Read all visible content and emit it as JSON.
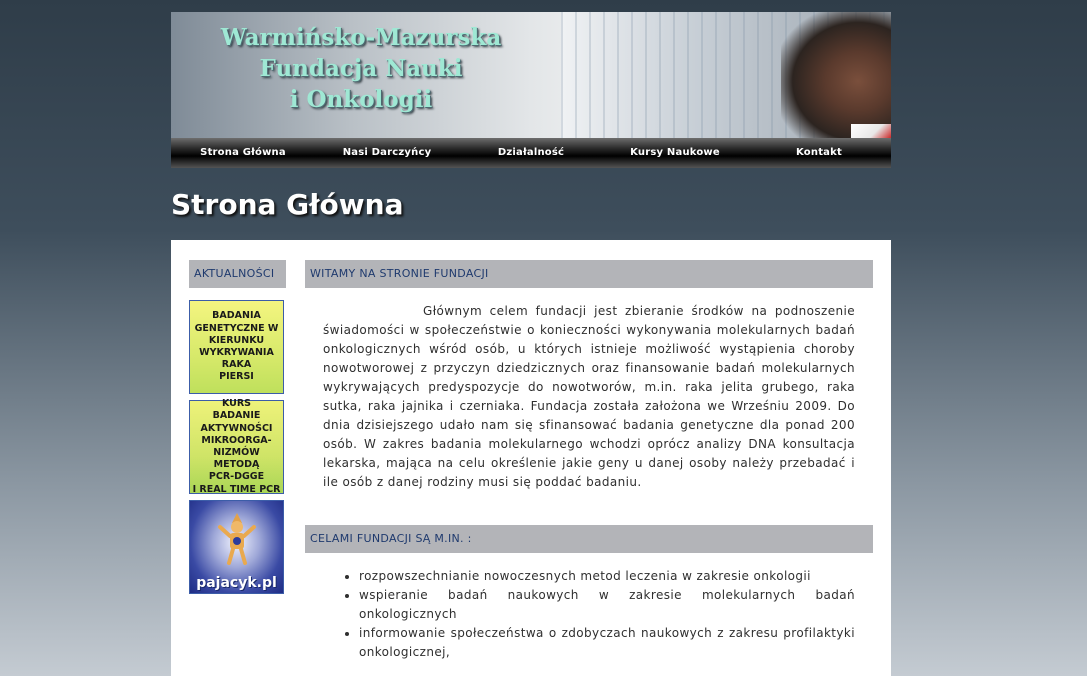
{
  "banner": {
    "title_lines": [
      "Warmińsko-Mazurska",
      "Fundacja Nauki",
      "i Onkologii"
    ]
  },
  "nav": {
    "items": [
      "Strona Główna",
      "Nasi Darczyńcy",
      "Działalność",
      "Kursy Naukowe",
      "Kontakt"
    ]
  },
  "page_title": "Strona Główna",
  "sidebar": {
    "heading": "AKTUALNOŚCI",
    "promos": [
      {
        "lines": [
          "BADANIA",
          "GENETYCZNE W",
          "KIERUNKU",
          "WYKRYWANIA",
          "RAKA",
          "PIERSI"
        ]
      },
      {
        "lines": [
          "KURS",
          "BADANIE",
          "AKTYWNOŚCI",
          "MIKROORGA-",
          "NIZMÓW METODĄ",
          "PCR-DGGE",
          "I REAL TIME PCR"
        ]
      },
      {
        "label": "pajacyk.pl"
      }
    ]
  },
  "main": {
    "welcome_heading": "WITAMY NA STRONIE FUNDACJI",
    "welcome_text": "Głównym celem fundacji jest zbieranie środków na podnoszenie świadomości w społeczeństwie o konieczności wykonywania molekularnych badań onkologicznych wśród osób, u których istnieje możliwość wystąpienia choroby nowotworowej z przyczyn dziedzicznych oraz finansowanie badań molekularnych wykrywających predyspozycje do nowotworów, m.in. raka jelita grubego, raka sutka, raka jajnika i czerniaka. Fundacja została założona we Wrześniu 2009. Do dnia dzisiejszego udało nam się sfinansować badania genetyczne dla ponad 200 osób. W zakres badania molekularnego wchodzi oprócz analizy DNA konsultacja lekarska, mająca na celu określenie jakie geny u danej osoby należy przebadać i ile osób z danej rodziny musi się poddać badaniu.",
    "goals_heading": "CELAMI FUNDACJI SĄ M.IN. :",
    "goals": [
      "rozpowszechnianie nowoczesnych metod leczenia w zakresie onkologii",
      "wspieranie badań naukowych w zakresie molekularnych badań onkologicznych",
      "informowanie społeczeństwa o zdobyczach naukowych z zakresu profilaktyki onkologicznej,"
    ]
  }
}
